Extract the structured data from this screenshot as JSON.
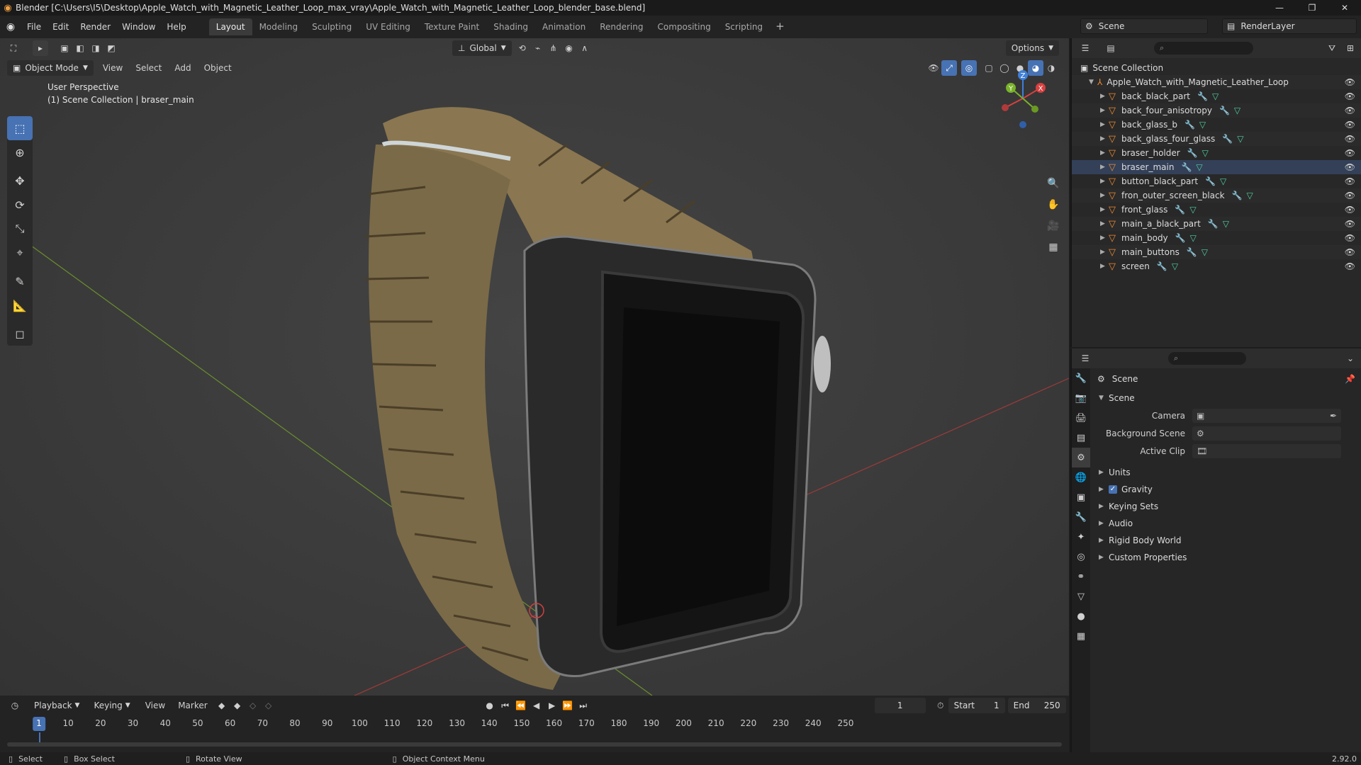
{
  "window": {
    "title": "Blender [C:\\Users\\I5\\Desktop\\Apple_Watch_with_Magnetic_Leather_Loop_max_vray\\Apple_Watch_with_Magnetic_Leather_Loop_blender_base.blend]",
    "controls": [
      "—",
      "❐",
      "✕"
    ]
  },
  "menu": [
    "File",
    "Edit",
    "Render",
    "Window",
    "Help"
  ],
  "workspaces": [
    "Layout",
    "Modeling",
    "Sculpting",
    "UV Editing",
    "Texture Paint",
    "Shading",
    "Animation",
    "Rendering",
    "Compositing",
    "Scripting"
  ],
  "add_workspace": "+",
  "scene_name": "Scene",
  "view_layer": "RenderLayer",
  "viewport": {
    "transform_orientation": "Global",
    "options_label": "Options",
    "mode": "Object Mode",
    "header_menu": [
      "View",
      "Select",
      "Add",
      "Object"
    ],
    "info_line1": "User Perspective",
    "info_line2": "(1) Scene Collection | braser_main",
    "gizmo": {
      "x": "X",
      "y": "Y",
      "z": "Z"
    }
  },
  "timeline": {
    "menu": [
      "Playback",
      "Keying",
      "View",
      "Marker"
    ],
    "current_frame": "1",
    "start_label": "Start",
    "start": "1",
    "end_label": "End",
    "end": "250",
    "ticks": [
      "1",
      "10",
      "20",
      "30",
      "40",
      "50",
      "60",
      "70",
      "80",
      "90",
      "100",
      "110",
      "120",
      "130",
      "140",
      "150",
      "160",
      "170",
      "180",
      "190",
      "200",
      "210",
      "220",
      "230",
      "240",
      "250"
    ]
  },
  "statusbar": {
    "select": "Select",
    "box_select": "Box Select",
    "rotate_view": "Rotate View",
    "context_menu": "Object Context Menu",
    "version": "2.92.0"
  },
  "outliner": {
    "root": "Scene Collection",
    "collection": "Apple_Watch_with_Magnetic_Leather_Loop",
    "objects": [
      "back_black_part",
      "back_four_anisotropy",
      "back_glass_b",
      "back_glass_four_glass",
      "braser_holder",
      "braser_main",
      "button_black_part",
      "fron_outer_screen_black",
      "front_glass",
      "main_a_black_part",
      "main_body",
      "main_buttons",
      "screen"
    ]
  },
  "properties": {
    "context": "Scene",
    "section": "Scene",
    "camera_label": "Camera",
    "background_label": "Background Scene",
    "clip_label": "Active Clip",
    "panels": [
      "Units",
      "Gravity",
      "Keying Sets",
      "Audio",
      "Rigid Body World",
      "Custom Properties"
    ]
  },
  "colors": {
    "accent": "#4772b3",
    "object_icon": "#f08a30",
    "mesh_icon": "#50d0a0"
  }
}
